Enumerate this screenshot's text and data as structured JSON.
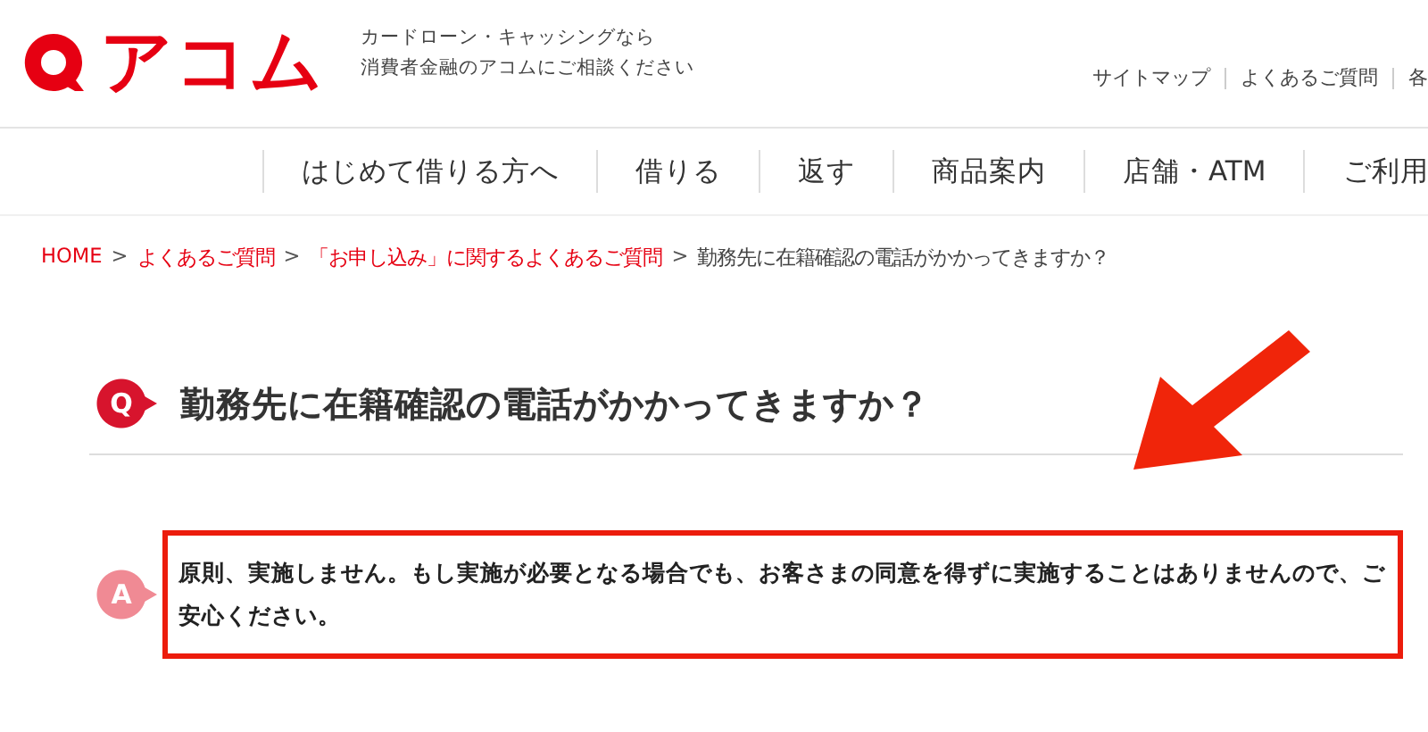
{
  "header": {
    "logo_text": "アコム",
    "tagline": [
      "カードローン・キャッシングなら",
      "消費者金融のアコムにご相談ください"
    ],
    "top_links": [
      "サイトマップ",
      "よくあるご質問",
      "各"
    ]
  },
  "nav": {
    "items": [
      "はじめて借りる方へ",
      "借りる",
      "返す",
      "商品案内",
      "店舗・ATM",
      "ご利用"
    ]
  },
  "breadcrumb": {
    "separator": ">",
    "items": [
      {
        "label": "HOME",
        "kind": "link"
      },
      {
        "label": "よくあるご質問",
        "kind": "link"
      },
      {
        "label": "「お申し込み」に関するよくあるご質問",
        "kind": "link"
      },
      {
        "label": "勤務先に在籍確認の電話がかかってきますか？",
        "kind": "current"
      }
    ]
  },
  "qa": {
    "question_mark": "Q",
    "question": "勤務先に在籍確認の電話がかかってきますか？",
    "answer_mark": "A",
    "answer": "原則、実施しません。もし実施が必要となる場合でも、お客さまの同意を得ずに実施することはありませんので、ご安心ください。",
    "highlighted": true
  }
}
